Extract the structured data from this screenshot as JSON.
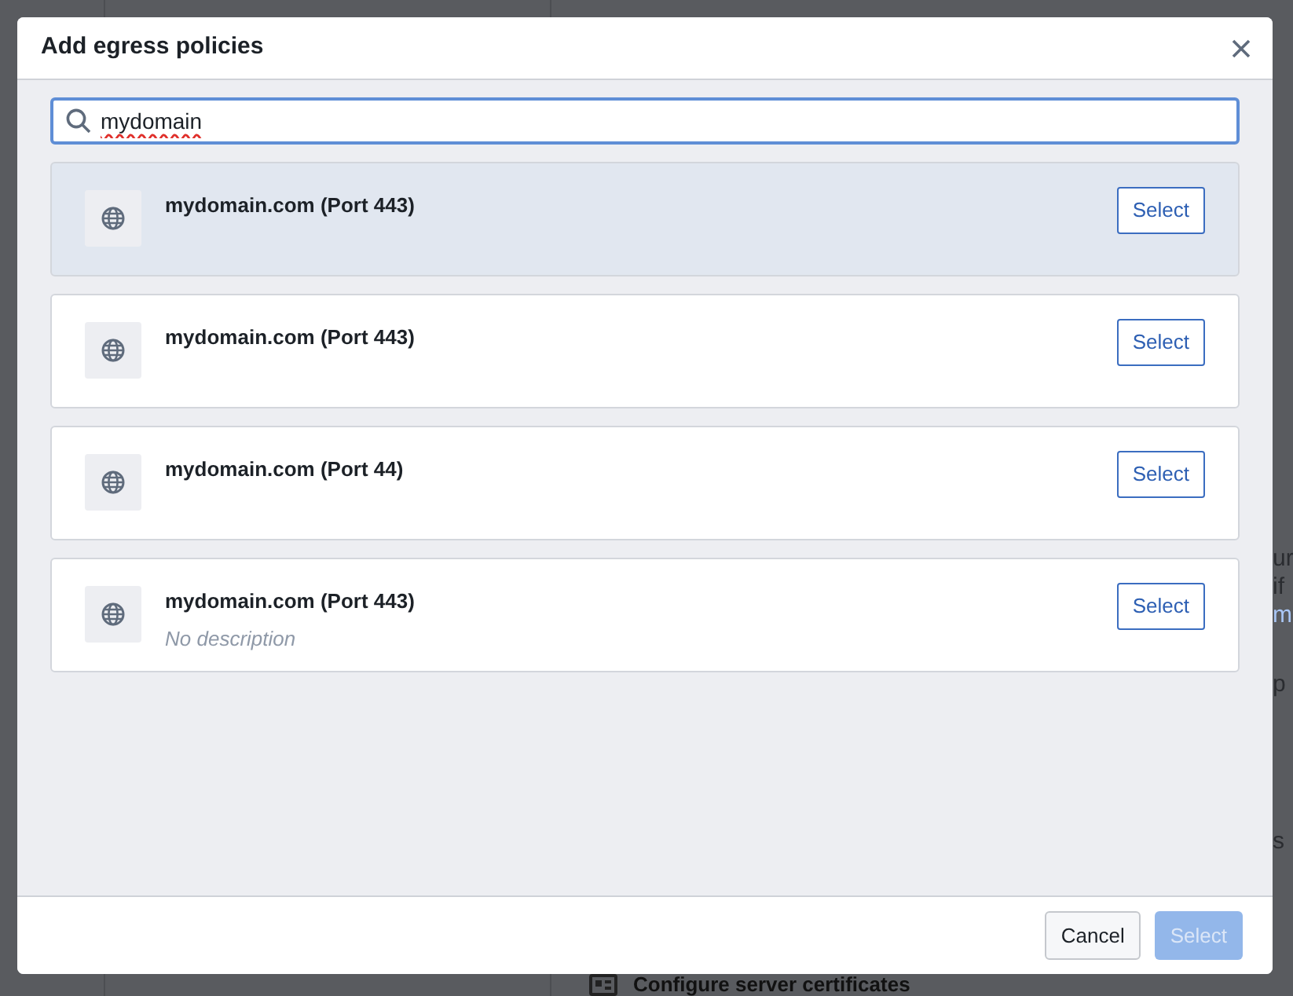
{
  "background": {
    "fragments": [
      {
        "text": "ur",
        "kind": "text"
      },
      {
        "text": "if",
        "kind": "text"
      },
      {
        "text": "m",
        "kind": "link"
      },
      {
        "text": "p",
        "kind": "text"
      },
      {
        "text": "s",
        "kind": "text"
      }
    ],
    "footer_item": "Configure server certificates"
  },
  "dialog": {
    "title": "Add egress policies",
    "search": {
      "value": "mydomain",
      "misspelled": true
    },
    "results": [
      {
        "name": "mydomain.com (Port 443)",
        "selected": true,
        "action": "Select"
      },
      {
        "name": "mydomain.com (Port 443)",
        "selected": false,
        "action": "Select"
      },
      {
        "name": "mydomain.com (Port 44)",
        "selected": false,
        "action": "Select"
      },
      {
        "name": "mydomain.com (Port 443)",
        "description": "No description",
        "selected": false,
        "action": "Select"
      }
    ],
    "cancel": "Cancel",
    "confirm": {
      "label": "Select",
      "disabled": true
    }
  }
}
